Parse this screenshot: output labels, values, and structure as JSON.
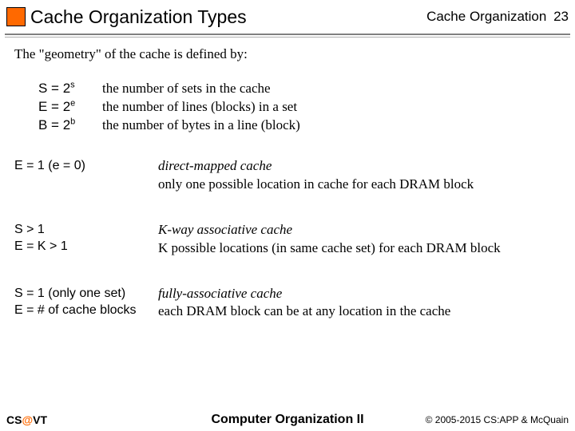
{
  "header": {
    "title": "Cache Organization Types",
    "right_label": "Cache Organization",
    "page_number": "23"
  },
  "intro": "The \"geometry\" of the cache is defined by:",
  "geometry": [
    {
      "sym": "S = 2",
      "exp": "s",
      "desc": "the number of sets in the cache"
    },
    {
      "sym": "E = 2",
      "exp": "e",
      "desc": "the number of lines (blocks) in a set"
    },
    {
      "sym": "B = 2",
      "exp": "b",
      "desc": "the number of bytes in a line (block)"
    }
  ],
  "cases": [
    {
      "cond1": "E = 1 (e = 0)",
      "cond2": "",
      "name": "direct-mapped cache",
      "desc": "only one possible location in cache for each DRAM block"
    },
    {
      "cond1": "S > 1",
      "cond2": "E = K > 1",
      "name": "K-way associative cache",
      "desc": "K possible locations (in same cache set) for each DRAM block"
    },
    {
      "cond1": "S = 1 (only one set)",
      "cond2": "E = # of cache blocks",
      "name": "fully-associative cache",
      "desc": "each DRAM block can be at any location in the cache"
    }
  ],
  "footer": {
    "left_pre": "CS",
    "left_at": "@",
    "left_post": "VT",
    "center": "Computer Organization II",
    "right": "© 2005-2015 CS:APP & McQuain"
  }
}
